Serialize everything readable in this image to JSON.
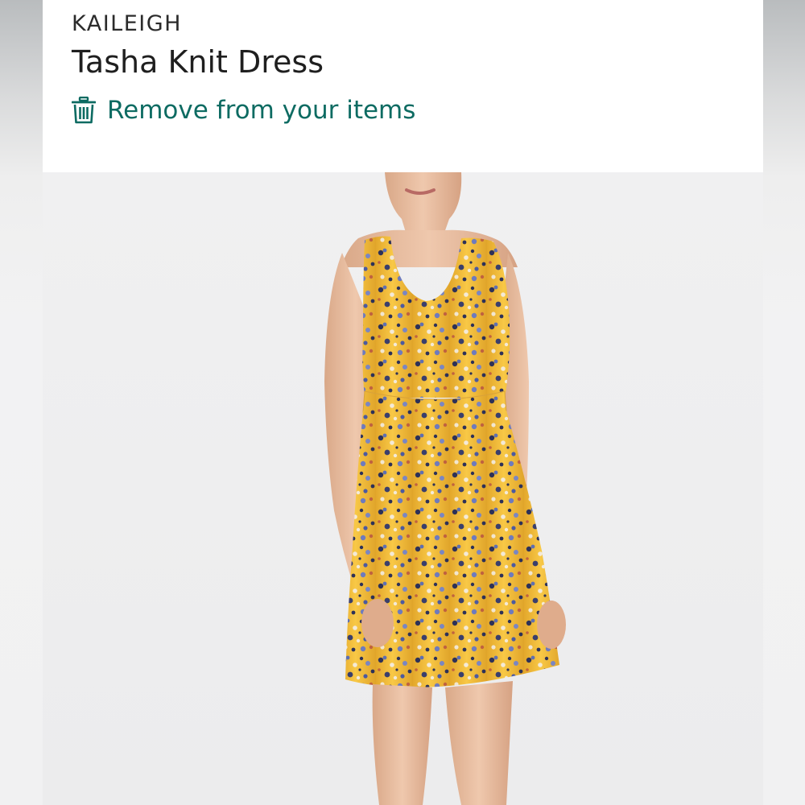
{
  "product": {
    "brand": "KAILEIGH",
    "name": "Tasha Knit Dress"
  },
  "actions": {
    "remove_label": "Remove from your items",
    "remove_icon": "trash-icon"
  },
  "colors": {
    "accent": "#0d6b62",
    "dress_base": "#f6c13f",
    "print_dark": "#2d3158",
    "print_blue": "#5e6fb2",
    "photo_background": "#efeff0"
  }
}
